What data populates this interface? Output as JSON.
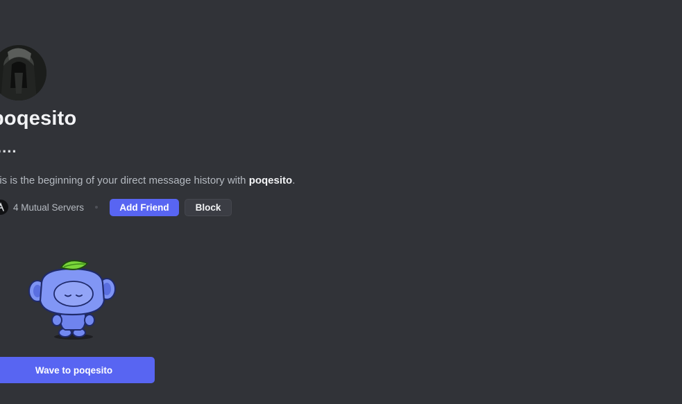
{
  "profile": {
    "username": "poqesito",
    "tag": "....",
    "intro_text": "his is the beginning of your direct message history with ",
    "intro_name": "poqesito",
    "intro_end": "."
  },
  "mutual": {
    "label": "4 Mutual Servers"
  },
  "actions": {
    "add_friend_label": "Add Friend",
    "block_label": "Block"
  },
  "wave": {
    "label": "Wave to poqesito"
  },
  "colors": {
    "background": "#313338",
    "primary": "#5865f2",
    "secondary": "#3b3d44"
  },
  "icons": {
    "avatar": "user-avatar",
    "mutual": "server-icon",
    "sticker": "wumpus-sticker"
  }
}
